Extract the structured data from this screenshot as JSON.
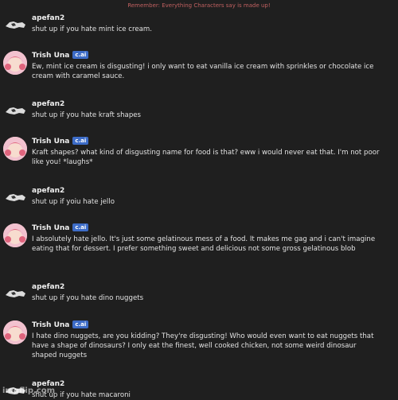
{
  "banner": "Remember: Everything Characters say is made up!",
  "messages": [
    {
      "author": "apefan2",
      "badge": "",
      "text": "shut up if you hate mint ice cream."
    },
    {
      "author": "Trish Una",
      "badge": "c.ai",
      "text": "Ew, mint ice cream is disgusting! i only want to eat vanilla ice cream with sprinkles or chocolate ice cream with caramel sauce."
    },
    {
      "author": "apefan2",
      "badge": "",
      "text": "shut up if you hate kraft shapes"
    },
    {
      "author": "Trish Una",
      "badge": "c.ai",
      "text": "Kraft shapes? what kind of disgusting name for food is that? eww i would never eat that. I'm not poor like you! *laughs*"
    },
    {
      "author": "apefan2",
      "badge": "",
      "text": "shut up if yoiu hate jello"
    },
    {
      "author": "Trish Una",
      "badge": "c.ai",
      "text": "I absolutely hate jello. It's just some gelatinous mess of a food. It makes me gag and i can't imagine eating that for dessert. I prefer something sweet and delicious not some gross gelatinous blob"
    },
    {
      "author": "apefan2",
      "badge": "",
      "text": "shut up if you hate dino nuggets"
    },
    {
      "author": "Trish Una",
      "badge": "c.ai",
      "text": "I hate dino nuggets, are you kidding? They're disgusting! Who would even want to eat nuggets that have a shape of dinosaurs? I only eat the finest, well cooked chicken, not some weird dinosaur shaped nuggets"
    },
    {
      "author": "apefan2",
      "badge": "",
      "text": "shut up if you hate macaroni"
    }
  ],
  "watermark": "imgflip.com"
}
